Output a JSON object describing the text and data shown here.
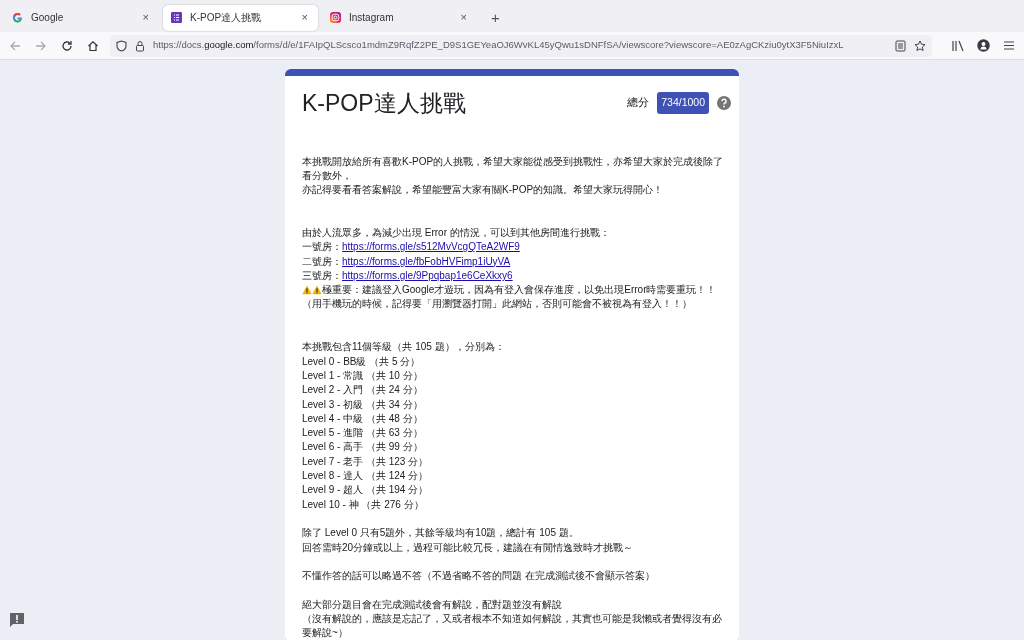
{
  "tabs": [
    {
      "label": "Google",
      "close": "×",
      "selected": false
    },
    {
      "label": "K-POP達人挑戰",
      "close": "×",
      "selected": true
    },
    {
      "label": "Instagram",
      "close": "×",
      "selected": false
    }
  ],
  "new_tab": "+",
  "address_bar": {
    "host_before": "https://docs.",
    "host": "google.com",
    "path": "/forms/d/e/1FAIpQLScsco1mdmZ9RqfZ2PE_D9S1GEYeaOJ6WvKL45yQwu1sDNFfSA/viewscore?viewscore=AE0zAgCKziu0ytX3F5NiuIzxL"
  },
  "form": {
    "title": "K-POP達人挑戰",
    "score_label": "總分",
    "score": "734/1000",
    "paragraphs": [
      [
        {
          "text": "本挑戰開放給所有喜歡K-POP的人挑戰，希望大家能從感受到挑戰性，亦希望大家於完成後除了看分數外，"
        },
        {
          "text": "亦記得要看看答案解說，希望能豐富大家有關K-POP的知識。希望大家玩得開心！"
        }
      ],
      [
        {
          "text": "由於人流眾多，為減少出現 Error 的情況，可以到其他房間進行挑戰："
        },
        {
          "text": "一號房：",
          "link": "https://forms.gle/s512MvVcgQTeA2WF9"
        },
        {
          "text": "二號房：",
          "link": "https://forms.gle/fbFobHVFimp1iUyVA"
        },
        {
          "text": "三號房：",
          "link": "https://forms.gle/9Ppqbap1e6CeXkxy6"
        },
        {
          "text": "極重要：建議登入Google才遊玩，因為有登入會保存進度，以免出現Error時需要重玩！！",
          "warning": true
        },
        {
          "text": "（用手機玩的時候，記得要「用瀏覽器打開」此網站，否則可能會不被視為有登入！！）"
        }
      ],
      [
        {
          "text": "本挑戰包含11個等級（共 105 題），分別為："
        },
        {
          "text": "Level 0 - BB級 （共 5 分）"
        },
        {
          "text": "Level 1 - 常識 （共 10 分）"
        },
        {
          "text": "Level 2 - 入門 （共 24 分）"
        },
        {
          "text": "Level 3 - 初級 （共 34 分）"
        },
        {
          "text": "Level 4 - 中級 （共 48 分）"
        },
        {
          "text": "Level 5 - 進階 （共 63 分）"
        },
        {
          "text": "Level 6 - 高手 （共 99 分）"
        },
        {
          "text": "Level 7 - 老手 （共 123 分）"
        },
        {
          "text": "Level 8 - 達人 （共 124 分）"
        },
        {
          "text": "Level 9 - 超人 （共 194 分）"
        },
        {
          "text": "Level 10 - 神 （共 276 分）"
        }
      ],
      [
        {
          "text": "除了 Level 0 只有5題外，其餘等級均有10題，總計有 105 題。"
        },
        {
          "text": "回答需時20分鐘或以上，過程可能比較冗長，建議在有閒情逸致時才挑戰～"
        }
      ],
      [
        {
          "text": "不懂作答的話可以略過不答（不過省略不答的問題 在完成測試後不會顯示答案）"
        }
      ],
      [
        {
          "text": "絕大部分題目會在完成測試後會有解說，配對題並沒有解說"
        },
        {
          "text": "（沒有解說的，應該是忘記了，又或者根本不知道如何解說，其實也可能是我懶或者覺得沒有必要解說~）"
        }
      ]
    ]
  }
}
